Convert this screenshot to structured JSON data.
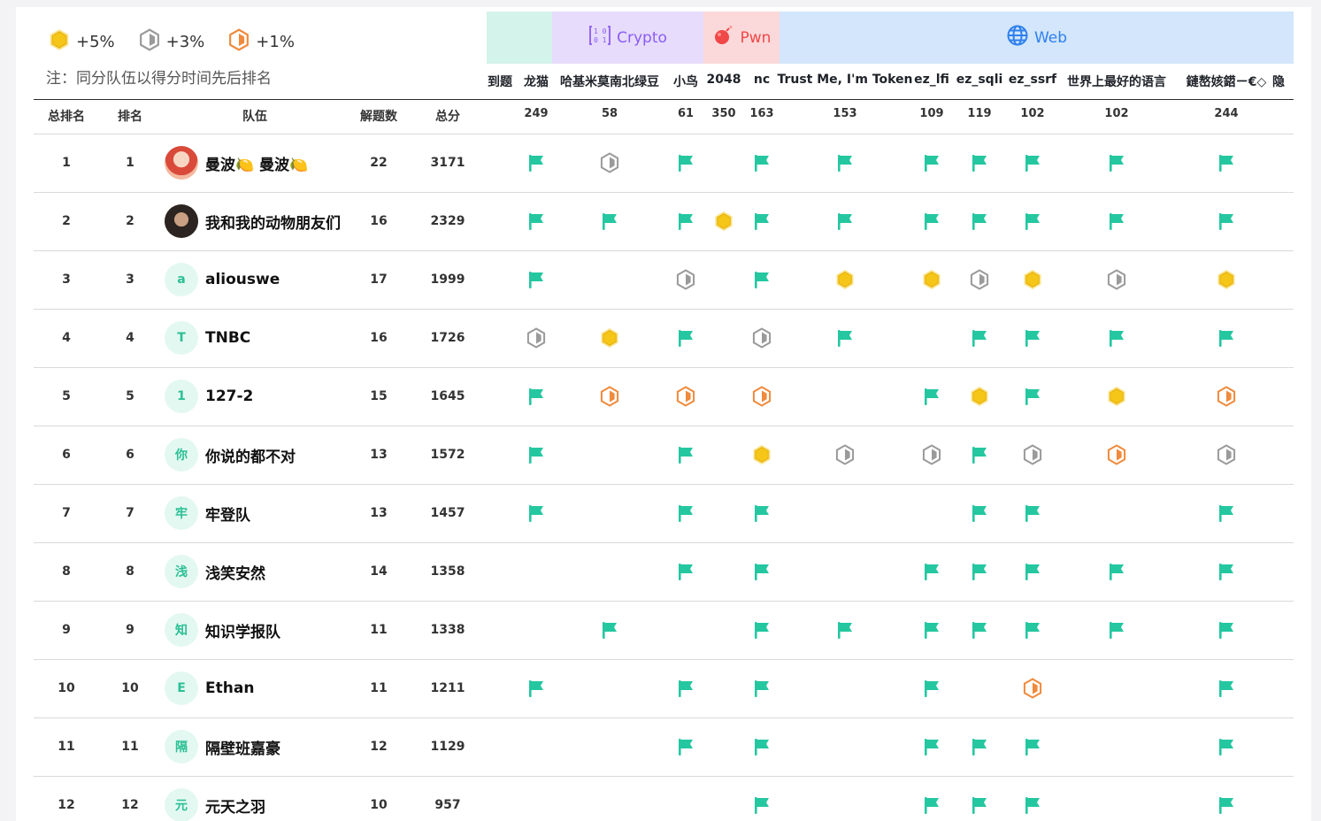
{
  "legend": [
    {
      "kind": "gold",
      "label": "+5%"
    },
    {
      "kind": "silver",
      "label": "+3%"
    },
    {
      "kind": "bronze",
      "label": "+1%"
    }
  ],
  "note": "注：同分队伍以得分时间先后排名",
  "categories": [
    {
      "name": "",
      "icon": "",
      "color": "#1f2329",
      "bg": "#d4f3ea"
    },
    {
      "name": "Crypto",
      "icon": "binary-icon",
      "color": "#8b5cf6",
      "bg": "#e7dcfb"
    },
    {
      "name": "Pwn",
      "icon": "bomb-icon",
      "color": "#f04848",
      "bg": "#fbd9da"
    },
    {
      "name": "Web",
      "icon": "globe-icon",
      "color": "#2f80ed",
      "bg": "#d3e6fb"
    }
  ],
  "headers": {
    "overall_rank": "总排名",
    "rank": "排名",
    "team": "队伍",
    "solved": "解题数",
    "total": "总分"
  },
  "challenges": [
    {
      "name": "到题",
      "score": ""
    },
    {
      "name": "龙猫",
      "score": "249"
    },
    {
      "name": "哈基米莫南北绿豆",
      "score": "58"
    },
    {
      "name": "小鸟",
      "score": "61"
    },
    {
      "name": "2048",
      "score": "350"
    },
    {
      "name": "nc",
      "score": "163"
    },
    {
      "name": "Trust Me, I'm Token",
      "score": "153"
    },
    {
      "name": "ez_lfi",
      "score": "109"
    },
    {
      "name": "ez_sqli",
      "score": "119"
    },
    {
      "name": "ez_ssrf",
      "score": "102"
    },
    {
      "name": "世界上最好的语言",
      "score": "102"
    },
    {
      "name": "鏈嶅姟鍣ㄧ€◇",
      "score": "244"
    },
    {
      "name": "隐",
      "score": ""
    }
  ],
  "rows": [
    {
      "overall": "1",
      "rank": "1",
      "avatar": "photo-avatar",
      "avatar_letter": "",
      "name": "曼波🍋 曼波🍋",
      "solved": "22",
      "total": "3171",
      "marks": [
        "",
        "flag",
        "silver",
        "flag",
        "",
        "flag",
        "flag",
        "flag",
        "flag",
        "flag",
        "flag",
        "flag",
        ""
      ]
    },
    {
      "overall": "2",
      "rank": "2",
      "avatar": "photo-avatar",
      "avatar_letter": "",
      "name": "我和我的动物朋友们",
      "solved": "16",
      "total": "2329",
      "marks": [
        "",
        "flag",
        "flag",
        "flag",
        "gold",
        "flag",
        "flag",
        "flag",
        "flag",
        "flag",
        "flag",
        "flag",
        ""
      ]
    },
    {
      "overall": "3",
      "rank": "3",
      "avatar": "letter-avatar",
      "avatar_letter": "a",
      "name": "aliouswe",
      "solved": "17",
      "total": "1999",
      "marks": [
        "",
        "flag",
        "",
        "silver",
        "",
        "flag",
        "gold",
        "gold",
        "silver",
        "gold",
        "silver",
        "gold",
        ""
      ]
    },
    {
      "overall": "4",
      "rank": "4",
      "avatar": "letter-avatar",
      "avatar_letter": "T",
      "name": "TNBC",
      "solved": "16",
      "total": "1726",
      "marks": [
        "",
        "silver",
        "gold",
        "flag",
        "",
        "silver",
        "flag",
        "",
        "flag",
        "flag",
        "flag",
        "flag",
        ""
      ]
    },
    {
      "overall": "5",
      "rank": "5",
      "avatar": "letter-avatar",
      "avatar_letter": "1",
      "name": "127-2",
      "solved": "15",
      "total": "1645",
      "marks": [
        "",
        "flag",
        "bronze",
        "bronze",
        "",
        "bronze",
        "",
        "flag",
        "gold",
        "flag",
        "gold",
        "bronze",
        ""
      ]
    },
    {
      "overall": "6",
      "rank": "6",
      "avatar": "letter-avatar",
      "avatar_letter": "你",
      "name": "你说的都不对",
      "solved": "13",
      "total": "1572",
      "marks": [
        "",
        "flag",
        "",
        "flag",
        "",
        "gold",
        "silver",
        "silver",
        "flag",
        "silver",
        "bronze",
        "silver",
        ""
      ]
    },
    {
      "overall": "7",
      "rank": "7",
      "avatar": "letter-avatar",
      "avatar_letter": "牢",
      "name": "牢登队",
      "solved": "13",
      "total": "1457",
      "marks": [
        "",
        "flag",
        "",
        "flag",
        "",
        "flag",
        "",
        "",
        "flag",
        "flag",
        "",
        "flag",
        ""
      ]
    },
    {
      "overall": "8",
      "rank": "8",
      "avatar": "letter-avatar",
      "avatar_letter": "浅",
      "name": "浅笑安然",
      "solved": "14",
      "total": "1358",
      "marks": [
        "",
        "",
        "",
        "flag",
        "",
        "flag",
        "",
        "flag",
        "flag",
        "flag",
        "flag",
        "flag",
        ""
      ]
    },
    {
      "overall": "9",
      "rank": "9",
      "avatar": "letter-avatar",
      "avatar_letter": "知",
      "name": "知识学报队",
      "solved": "11",
      "total": "1338",
      "marks": [
        "",
        "",
        "flag",
        "",
        "",
        "flag",
        "flag",
        "flag",
        "flag",
        "flag",
        "flag",
        "flag",
        ""
      ]
    },
    {
      "overall": "10",
      "rank": "10",
      "avatar": "letter-avatar",
      "avatar_letter": "E",
      "name": "Ethan",
      "solved": "11",
      "total": "1211",
      "marks": [
        "",
        "flag",
        "",
        "flag",
        "",
        "flag",
        "",
        "flag",
        "",
        "bronze",
        "",
        "flag",
        ""
      ]
    },
    {
      "overall": "11",
      "rank": "11",
      "avatar": "letter-avatar",
      "avatar_letter": "隔",
      "name": "隔壁班嘉豪",
      "solved": "12",
      "total": "1129",
      "marks": [
        "",
        "",
        "",
        "flag",
        "",
        "flag",
        "",
        "flag",
        "flag",
        "flag",
        "",
        "flag",
        ""
      ]
    },
    {
      "overall": "12",
      "rank": "12",
      "avatar": "letter-avatar",
      "avatar_letter": "元",
      "name": "元天之羽",
      "solved": "10",
      "total": "957",
      "marks": [
        "",
        "",
        "",
        "",
        "",
        "flag",
        "",
        "flag",
        "flag",
        "flag",
        "",
        "flag",
        ""
      ]
    }
  ],
  "colors": {
    "flag": "#24c7a0",
    "gold": "#f5c518",
    "silver": "#9a9a9a",
    "bronze": "#f08a3c"
  }
}
